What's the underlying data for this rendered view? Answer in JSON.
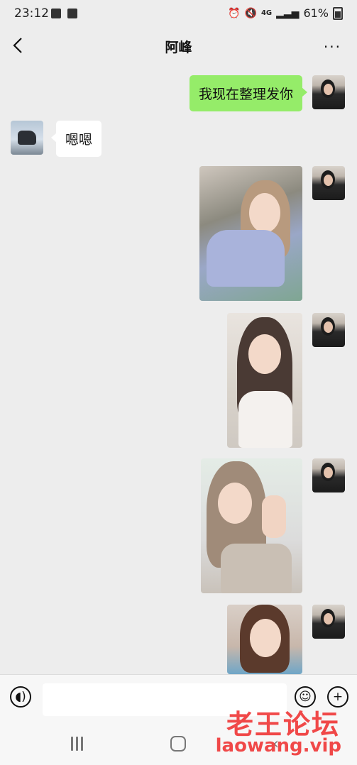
{
  "status_bar": {
    "time": "23:12",
    "network": "4G",
    "battery": "61%"
  },
  "header": {
    "title": "阿峰",
    "back_icon": "chevron-left-icon",
    "more_label": "···"
  },
  "messages": [
    {
      "side": "out",
      "type": "text",
      "text": "我现在整理发你"
    },
    {
      "side": "in",
      "type": "text",
      "text": "嗯嗯"
    },
    {
      "side": "out",
      "type": "image",
      "description_icon": "photo-icon"
    },
    {
      "side": "out",
      "type": "image",
      "description_icon": "photo-icon"
    },
    {
      "side": "out",
      "type": "image",
      "description_icon": "photo-icon"
    },
    {
      "side": "out",
      "type": "image",
      "description_icon": "photo-icon"
    }
  ],
  "input_bar": {
    "placeholder": ""
  },
  "watermark": {
    "title": "老王论坛",
    "url": "laowang.vip"
  },
  "colors": {
    "outgoing_bubble": "#95ec69",
    "incoming_bubble": "#ffffff",
    "background": "#ededed",
    "watermark": "#f03a3a"
  }
}
